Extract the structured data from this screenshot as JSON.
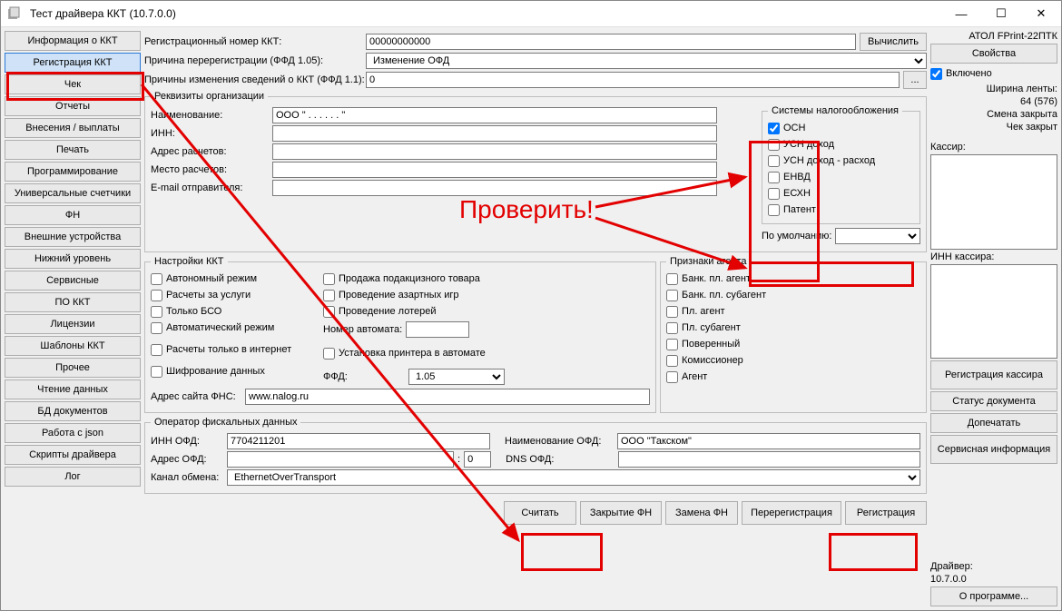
{
  "window": {
    "title": "Тест драйвера ККТ (10.7.0.0)",
    "min": "—",
    "max": "☐",
    "close": "✕"
  },
  "nav": [
    "Информация о ККТ",
    "Регистрация ККТ",
    "Чек",
    "Отчеты",
    "Внесения / выплаты",
    "Печать",
    "Программирование",
    "Универсальные счетчики",
    "ФН",
    "Внешние устройства",
    "Нижний уровень",
    "Сервисные",
    "ПО ККТ",
    "Лицензии",
    "Шаблоны ККТ",
    "Прочее",
    "Чтение данных",
    "БД документов",
    "Работа с json",
    "Скрипты драйвера",
    "Лог"
  ],
  "top": {
    "regnum_lbl": "Регистрационный номер ККТ:",
    "regnum_val": "00000000000",
    "calc_btn": "Вычислить",
    "rereg_lbl": "Причина перерегистрации (ФФД 1.05):",
    "rereg_val": "Изменение ОФД",
    "changes_lbl": "Причины изменения сведений о ККТ (ФФД 1.1):",
    "changes_val": "0",
    "changes_btn": "..."
  },
  "org": {
    "legend": "Реквизиты организации",
    "name_lbl": "Наименование:",
    "name_val": "ООО \" . . . . . . \"",
    "inn_lbl": "ИНН:",
    "inn_val": "",
    "addr_lbl": "Адрес расчетов:",
    "addr_val": "",
    "place_lbl": "Место расчетов:",
    "place_val": "",
    "email_lbl": "E-mail отправителя:",
    "email_val": ""
  },
  "tax": {
    "legend": "Системы налогообложения",
    "items": [
      "ОСН",
      "УСН доход",
      "УСН доход - расход",
      "ЕНВД",
      "ЕСХН",
      "Патент"
    ],
    "osn_checked": true,
    "default_lbl": "По умолчанию:",
    "default_val": ""
  },
  "kkt": {
    "legend": "Настройки ККТ",
    "left": [
      "Автономный режим",
      "Расчеты за услуги",
      "Только БСО",
      "Автоматический режим",
      "Расчеты только в интернет",
      "Шифрование данных"
    ],
    "mid": [
      "Продажа подакцизного товара",
      "Проведение азартных игр",
      "Проведение лотерей"
    ],
    "autonum_lbl": "Номер автомата:",
    "autonum_val": "",
    "printer_chk": "Установка принтера в автомате",
    "ffd_lbl": "ФФД:",
    "ffd_val": "1.05",
    "fns_lbl": "Адрес сайта ФНС:",
    "fns_val": "www.nalog.ru"
  },
  "agent": {
    "legend": "Признаки агента",
    "items": [
      "Банк. пл. агент",
      "Банк. пл. субагент",
      "Пл. агент",
      "Пл. субагент",
      "Поверенный",
      "Комиссионер",
      "Агент"
    ]
  },
  "ofd": {
    "legend": "Оператор фискальных данных",
    "inn_lbl": "ИНН ОФД:",
    "inn_val": "7704211201",
    "name_lbl": "Наименование ОФД:",
    "name_val": "ООО \"Такском\"",
    "addr_lbl": "Адрес ОФД:",
    "addr_val": "",
    "port_val": "0",
    "dns_lbl": "DNS ОФД:",
    "dns_val": "",
    "channel_lbl": "Канал обмена:",
    "channel_val": "EthernetOverTransport"
  },
  "bottom": {
    "read": "Считать",
    "closefn": "Закрытие ФН",
    "replacefn": "Замена ФН",
    "rereg": "Перерегистрация",
    "reg": "Регистрация"
  },
  "aside": {
    "device": "АТОЛ FPrint-22ПТК",
    "props_btn": "Свойства",
    "enabled_chk": "Включено",
    "tape_lbl": "Ширина ленты:",
    "tape_val": "64 (576)",
    "shift_lbl": "Смена закрыта",
    "check_lbl": "Чек закрыт",
    "cashier_lbl": "Кассир:",
    "cashier_val": "",
    "cashier_inn_lbl": "ИНН кассира:",
    "cashier_inn_val": "",
    "reg_cashier_btn": "Регистрация кассира",
    "status_btn": "Статус документа",
    "reprint_btn": "Допечатать",
    "service_btn": "Сервисная информация",
    "driver_lbl": "Драйвер:",
    "driver_ver": "10.7.0.0",
    "about_btn": "О программе..."
  },
  "annotation": "Проверить!"
}
